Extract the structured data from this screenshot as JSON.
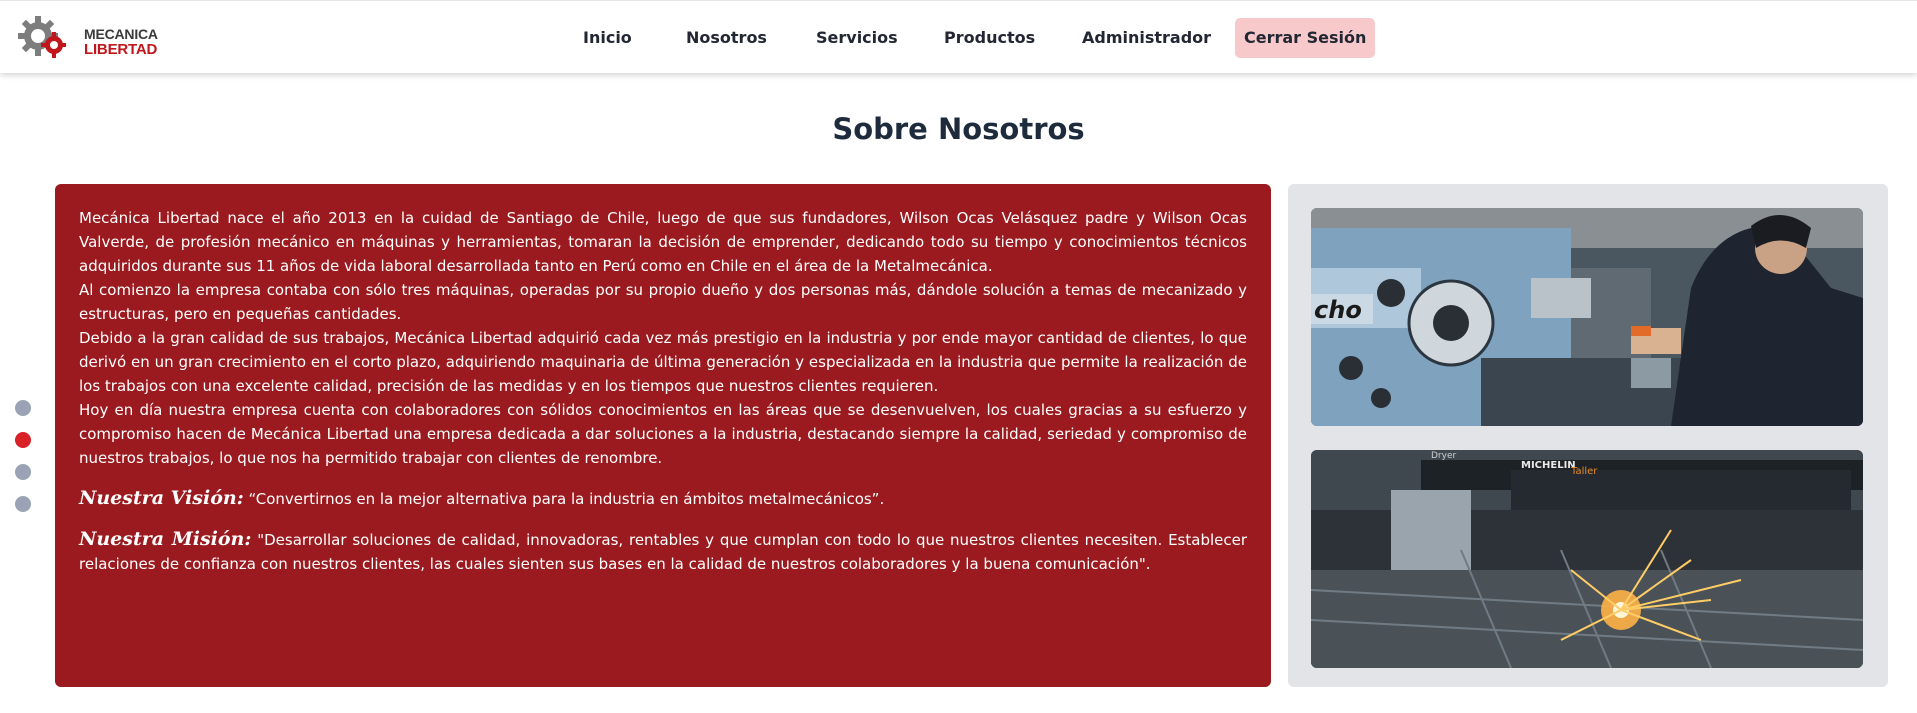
{
  "logo": {
    "line1": "MECANICA",
    "line2": "LIBERTAD",
    "icon": "gear-logo-icon"
  },
  "nav": [
    {
      "label": "Inicio"
    },
    {
      "label": "Nosotros"
    },
    {
      "label": "Servicios"
    },
    {
      "label": "Productos"
    },
    {
      "label": "Administrador"
    },
    {
      "label": "Cerrar Sesión"
    }
  ],
  "title": "Sobre Nosotros",
  "carousel": {
    "total": 4,
    "active_index": 2
  },
  "about": {
    "paragraphs": [
      "Mecánica Libertad nace el año 2013 en la cuidad de Santiago de Chile, luego de que sus fundadores, Wilson Ocas Velásquez padre y Wilson Ocas Valverde, de profesión mecánico en máquinas y herramientas, tomaran la decisión de emprender, dedicando todo su tiempo y conocimientos técnicos adquiridos durante sus 11 años de vida laboral desarrollada tanto en Perú como en Chile en el área de la Metalmecánica.",
      "Al comienzo la empresa contaba con sólo tres máquinas, operadas por su propio dueño y dos personas más, dándole solución a temas de mecanizado y estructuras, pero en pequeñas cantidades.",
      "Debido a la gran calidad de sus trabajos, Mecánica Libertad adquirió cada vez más prestigio en la industria y por ende mayor cantidad de clientes, lo que derivó en un gran crecimiento en el corto plazo, adquiriendo maquinaria de última generación y especializada en la industria que permite la realización de los trabajos con una excelente calidad, precisión de las medidas y en los tiempos que nuestros clientes requieren.",
      "Hoy en día nuestra empresa cuenta con colaboradores con sólidos conocimientos en las áreas que se desenvuelven, los cuales gracias a su esfuerzo y compromiso hacen de Mecánica Libertad una empresa dedicada a dar soluciones a la industria, destacando siempre la calidad, seriedad y compromiso de nuestros trabajos, lo que nos ha permitido trabajar con clientes de renombre."
    ],
    "vision_label": "Nuestra Visión:",
    "vision_text": "“Convertirnos en la mejor alternativa para la industria en ámbitos metalmecánicos”.",
    "mission_label": "Nuestra Misión:",
    "mission_text": "\"Desarrollar soluciones de calidad, innovadoras, rentables y que cumplan con todo lo que nuestros clientes necesiten. Establecer relaciones de confianza con nuestros clientes, las cuales sienten sus bases en la calidad de nuestros colaboradores y la buena comunicación\"."
  },
  "photos": {
    "lathe_brand": "cho",
    "sticker_1": "Dryer",
    "sticker_2": "MICHELIN",
    "sticker_3": "Taller"
  },
  "colors": {
    "panel_red": "#9a1a1f",
    "logout_bg": "#f8c9cb",
    "title": "#1e2b3c",
    "dot_active": "#d92228",
    "dot_inactive": "#9aa3b5",
    "gallery_bg": "#e2e4e8"
  }
}
